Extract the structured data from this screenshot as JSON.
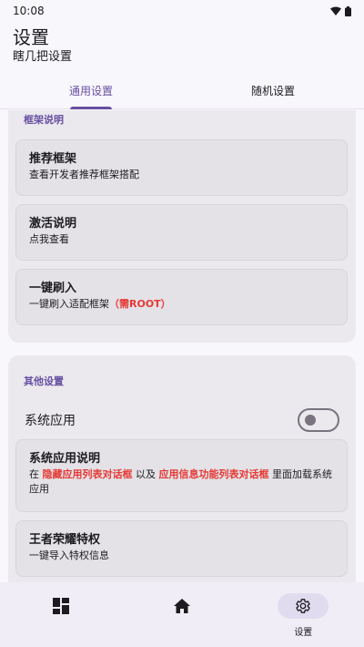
{
  "status_bar": {
    "time": "10:08"
  },
  "header": {
    "title": "设置",
    "subtitle": "瞎几把设置"
  },
  "tabs": [
    {
      "label": "通用设置",
      "active": true
    },
    {
      "label": "随机设置",
      "active": false
    }
  ],
  "sections": {
    "framework": {
      "title": "框架说明",
      "items": [
        {
          "title": "推荐框架",
          "desc": "查看开发者推荐框架搭配"
        },
        {
          "title": "激活说明",
          "desc": "点我查看"
        },
        {
          "title": "一键刷入",
          "desc": "一键刷入适配框架",
          "desc_highlight": "（需ROOT）"
        }
      ]
    },
    "other": {
      "title": "其他设置",
      "switch": {
        "label": "系统应用",
        "on": false
      },
      "items": [
        {
          "title": "系统应用说明",
          "desc_parts": [
            "在 ",
            "隐藏应用列表对话框",
            " 以及 ",
            "应用信息功能列表对话框",
            " 里面加载系统应用"
          ]
        },
        {
          "title": "王者荣耀特权",
          "desc": "一键导入特权信息"
        }
      ]
    }
  },
  "bottom_nav": [
    {
      "icon": "dashboard-icon",
      "label": "",
      "active": false
    },
    {
      "icon": "home-icon",
      "label": "",
      "active": false
    },
    {
      "icon": "gear-icon",
      "label": "设置",
      "active": true
    }
  ],
  "colors": {
    "accent": "#6750a4",
    "warning": "#e53935"
  }
}
